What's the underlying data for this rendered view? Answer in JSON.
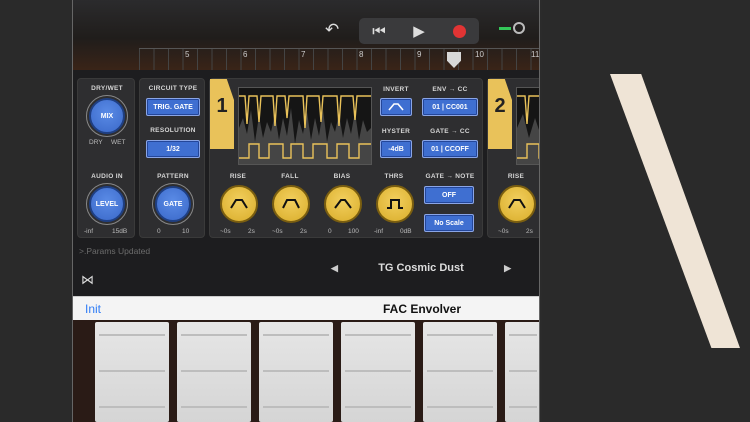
{
  "transport": {
    "undo": "↶",
    "rewind": "⏮",
    "play": "▶",
    "record": "record"
  },
  "ruler": {
    "marks": [
      "5",
      "6",
      "7",
      "8",
      "9",
      "10",
      "11"
    ]
  },
  "plugin": {
    "drywet": {
      "label": "DRY/WET",
      "knob": "MIX",
      "min": "DRY",
      "max": "WET"
    },
    "audioin": {
      "label": "AUDIO IN",
      "knob": "LEVEL",
      "min": "-inf",
      "max": "15dB"
    },
    "circuit": {
      "label": "CIRCUIT TYPE",
      "value": "TRIG. GATE"
    },
    "resolution": {
      "label": "RESOLUTION",
      "value": "1/32"
    },
    "pattern": {
      "label": "PATTERN",
      "knob": "GATE",
      "min": "0",
      "max": "10"
    },
    "slot1": {
      "number": "1",
      "invert_label": "INVERT",
      "hyster_label": "HYSTER",
      "hyster_value": "-4dB",
      "env_cc_label": "ENV → CC",
      "env_cc_value": "01 | CC001",
      "gate_cc_label": "GATE → CC",
      "gate_cc_value": "01 | CCOFF",
      "gate_note_label": "GATE → NOTE",
      "gate_note_value": "OFF",
      "scale_value": "No Scale",
      "knobs": [
        {
          "label": "RISE",
          "min": "~0s",
          "max": "2s"
        },
        {
          "label": "FALL",
          "min": "~0s",
          "max": "2s"
        },
        {
          "label": "BIAS",
          "min": "0",
          "max": "100"
        },
        {
          "label": "THRS",
          "min": "-inf",
          "max": "0dB"
        }
      ]
    },
    "slot2": {
      "number": "2",
      "knob": {
        "label": "RISE",
        "min": "~0s",
        "max": "2s"
      }
    }
  },
  "status": ">.Params Updated",
  "preset": {
    "name": "TG Cosmic Dust",
    "prev": "◀",
    "next": "▶"
  },
  "header": {
    "init": "Init",
    "title": "FAC Envolver"
  },
  "colors": {
    "accent_blue": "#3f6fd1",
    "accent_yellow": "#e9c25a",
    "record": "#e13434"
  }
}
